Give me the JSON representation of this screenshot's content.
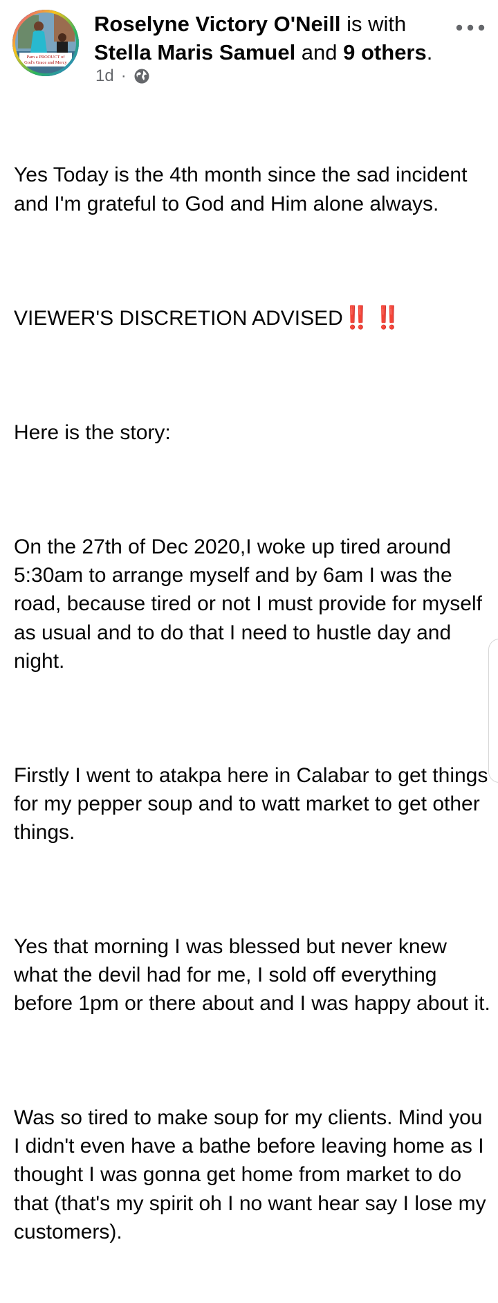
{
  "post": {
    "author": "Roselyne Victory O'Neill",
    "with_text": " is with",
    "tagged_person": "Stella Maris Samuel",
    "and_text": " and ",
    "others": "9 others",
    "period": ".",
    "time": "1d",
    "separator": "·",
    "privacy_icon": "globe-icon",
    "more_icon": "ellipsis-icon",
    "avatar_text": "Pam a PRODUCT of God's Grace and Mercy",
    "paragraphs": {
      "p1": "Yes Today is the 4th month since the sad incident and I'm grateful to God and Him alone always.",
      "p2": "VIEWER'S DISCRETION ADVISED",
      "p2_emoji": "‼️ ‼️",
      "p3": "Here is the story:",
      "p4": "On the 27th of Dec 2020,I woke up tired around 5:30am to arrange myself and by 6am I was the road, because tired or not I must provide for myself as usual and to do that I need to hustle day and night.",
      "p5": "Firstly I went to atakpa here in Calabar to get things for my pepper soup and to watt market to get other things.",
      "p6": "Yes that morning I was blessed but never knew what the devil had for me, I sold off everything before 1pm or there about and I was happy about it.",
      "p7": "Was so tired to make soup for my clients. Mind you I didn't even have a bathe before leaving home as I  thought I was gonna get home from market to do that (that's my spirit oh I no want hear say I lose my customers)."
    }
  },
  "colors": {
    "text": "#050505",
    "meta": "#65676b",
    "emoji": "#e0271e"
  }
}
